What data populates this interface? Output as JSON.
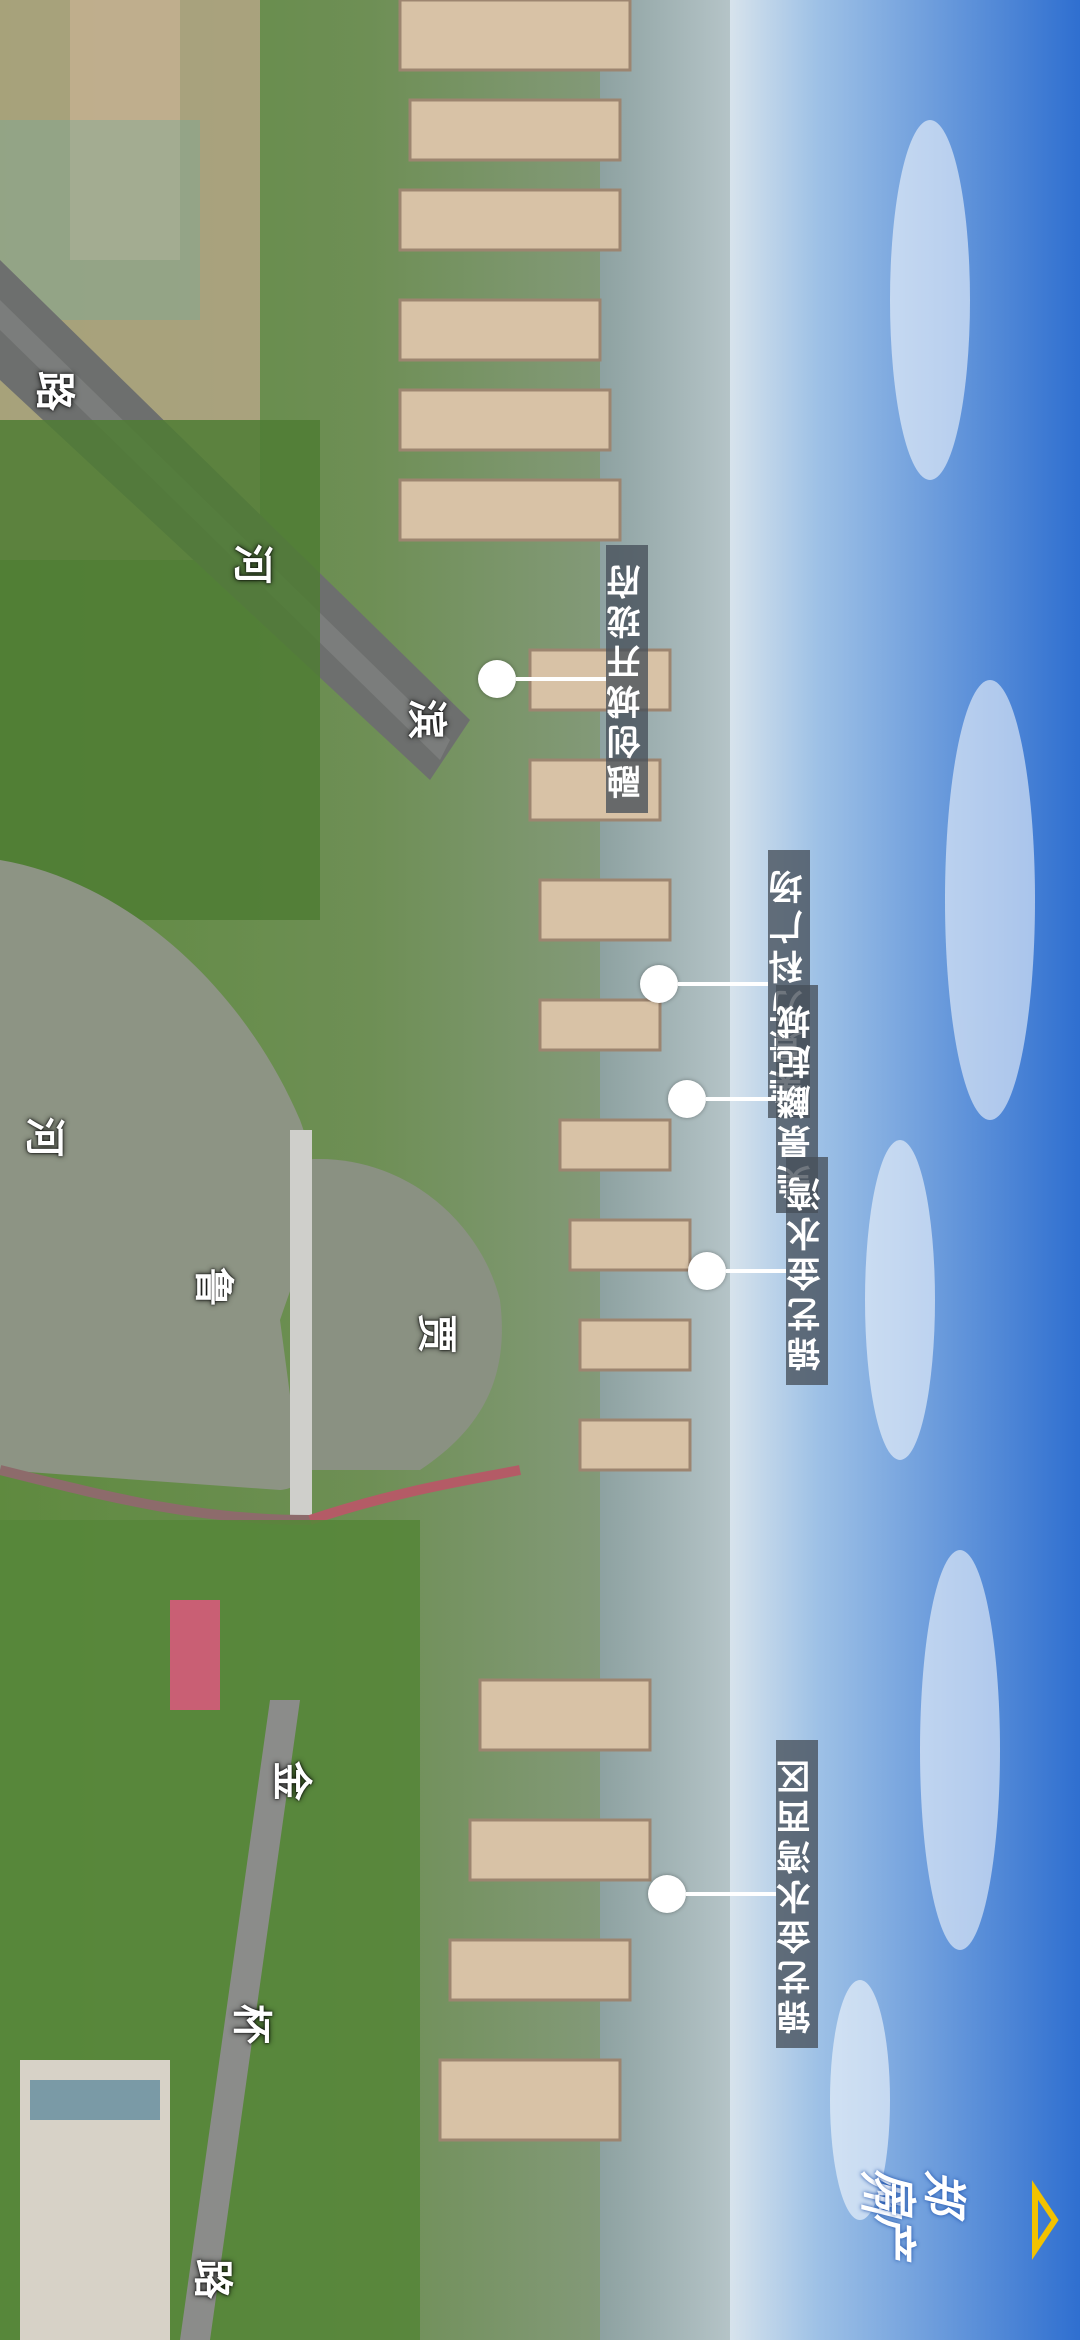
{
  "image": {
    "orientation": "rotated-90",
    "colors": {
      "sky": "#3a78d0",
      "water": "#8d9484",
      "greenery": "#5c8a3e",
      "road": "#6d6f6e"
    }
  },
  "callouts": [
    {
      "label": "融创城开珑府"
    },
    {
      "label": "美景万科广场"
    },
    {
      "label": "美景麟起城"
    },
    {
      "label": "锦艺金水湾"
    },
    {
      "label": "锦艺金水湾西区"
    }
  ],
  "road_labels": [
    {
      "text": "路"
    },
    {
      "text": "河"
    },
    {
      "text": "滨"
    },
    {
      "text": "河"
    },
    {
      "text": "鲁"
    },
    {
      "text": "贾"
    },
    {
      "text": "金"
    },
    {
      "text": "杯"
    },
    {
      "text": "路"
    }
  ],
  "logo": {
    "line1": "郑州",
    "line2": "房产",
    "icon": "house-roof-icon"
  }
}
